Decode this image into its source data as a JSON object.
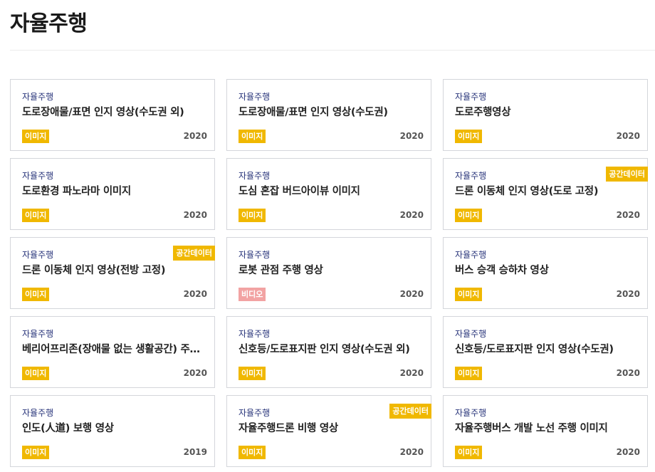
{
  "page": {
    "title": "자율주행"
  },
  "colors": {
    "accent_badge": "#f0b800",
    "video_badge": "#f2a3a3",
    "category_text": "#28347a"
  },
  "cards": [
    {
      "category": "자율주행",
      "title": "도로장애물/표면 인지 영상(수도권 외)",
      "type": "이미지",
      "year": "2020",
      "spatial": ""
    },
    {
      "category": "자율주행",
      "title": "도로장애물/표면 인지 영상(수도권)",
      "type": "이미지",
      "year": "2020",
      "spatial": ""
    },
    {
      "category": "자율주행",
      "title": "도로주행영상",
      "type": "이미지",
      "year": "2020",
      "spatial": ""
    },
    {
      "category": "자율주행",
      "title": "도로환경 파노라마 이미지",
      "type": "이미지",
      "year": "2020",
      "spatial": ""
    },
    {
      "category": "자율주행",
      "title": "도심 혼잡 버드아이뷰 이미지",
      "type": "이미지",
      "year": "2020",
      "spatial": ""
    },
    {
      "category": "자율주행",
      "title": "드론 이동체 인지 영상(도로 고정)",
      "type": "이미지",
      "year": "2020",
      "spatial": "공간데이터"
    },
    {
      "category": "자율주행",
      "title": "드론 이동체 인지 영상(전방 고정)",
      "type": "이미지",
      "year": "2020",
      "spatial": "공간데이터"
    },
    {
      "category": "자율주행",
      "title": "로봇 관점 주행 영상",
      "type": "비디오",
      "year": "2020",
      "spatial": ""
    },
    {
      "category": "자율주행",
      "title": "버스 승객 승하차 영상",
      "type": "이미지",
      "year": "2020",
      "spatial": ""
    },
    {
      "category": "자율주행",
      "title": "베리어프리존(장애물 없는 생활공간) 주…",
      "type": "이미지",
      "year": "2020",
      "spatial": ""
    },
    {
      "category": "자율주행",
      "title": "신호등/도로표지판 인지 영상(수도권 외)",
      "type": "이미지",
      "year": "2020",
      "spatial": ""
    },
    {
      "category": "자율주행",
      "title": "신호등/도로표지판 인지 영상(수도권)",
      "type": "이미지",
      "year": "2020",
      "spatial": ""
    },
    {
      "category": "자율주행",
      "title": "인도(人道) 보행 영상",
      "type": "이미지",
      "year": "2019",
      "spatial": ""
    },
    {
      "category": "자율주행",
      "title": "자율주행드론 비행 영상",
      "type": "이미지",
      "year": "2020",
      "spatial": "공간데이터"
    },
    {
      "category": "자율주행",
      "title": "자율주행버스 개발 노선 주행 이미지",
      "type": "이미지",
      "year": "2020",
      "spatial": ""
    }
  ]
}
